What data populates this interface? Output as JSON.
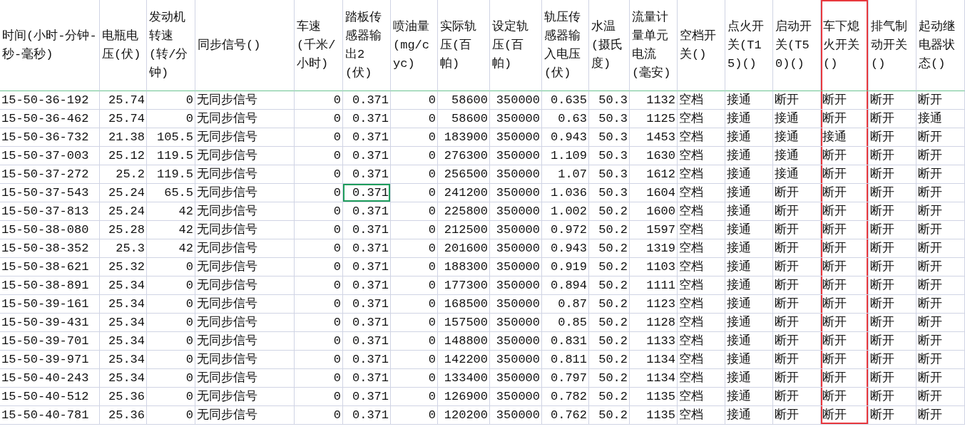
{
  "columns": [
    {
      "label": "时间(小时-分钟-秒-毫秒)",
      "kind": "text",
      "highlighted": false
    },
    {
      "label": "电瓶电压(伏)",
      "kind": "number",
      "highlighted": false
    },
    {
      "label": "发动机转速(转/分钟)",
      "kind": "number",
      "highlighted": false
    },
    {
      "label": "同步信号()",
      "kind": "text",
      "highlighted": false
    },
    {
      "label": "车速(千米/小时)",
      "kind": "number",
      "highlighted": false
    },
    {
      "label": "踏板传感器输出2(伏)",
      "kind": "number",
      "highlighted": false
    },
    {
      "label": "喷油量(mg/cyc)",
      "kind": "number",
      "highlighted": false
    },
    {
      "label": "实际轨压(百帕)",
      "kind": "number",
      "highlighted": false
    },
    {
      "label": "设定轨压(百帕)",
      "kind": "number",
      "highlighted": false
    },
    {
      "label": "轨压传感器输入电压(伏)",
      "kind": "number",
      "highlighted": false
    },
    {
      "label": "水温(摄氏度)",
      "kind": "number",
      "highlighted": false
    },
    {
      "label": "流量计量单元电流(毫安)",
      "kind": "number",
      "highlighted": false
    },
    {
      "label": "空档开关()",
      "kind": "text",
      "highlighted": false
    },
    {
      "label": "点火开关(T15)()",
      "kind": "text",
      "highlighted": false
    },
    {
      "label": "启动开关(T50)()",
      "kind": "text",
      "highlighted": false
    },
    {
      "label": "车下熄火开关()",
      "kind": "text",
      "highlighted": true
    },
    {
      "label": "排气制动开关()",
      "kind": "text",
      "highlighted": false
    },
    {
      "label": "起动继电器状态()",
      "kind": "text",
      "highlighted": false
    }
  ],
  "rows": [
    {
      "cells": [
        "15-50-36-192",
        "25.74",
        "0",
        "无同步信号",
        "0",
        "0.371",
        "0",
        "58600",
        "350000",
        "0.635",
        "50.3",
        "1132",
        "空档",
        "接通",
        "断开",
        "断开",
        "断开",
        "断开"
      ],
      "selected_cell": [
        false,
        false,
        false,
        false,
        false,
        false,
        false,
        false,
        false,
        false,
        false,
        false,
        false,
        false,
        false,
        false,
        false,
        false
      ]
    },
    {
      "cells": [
        "15-50-36-462",
        "25.74",
        "0",
        "无同步信号",
        "0",
        "0.371",
        "0",
        "58600",
        "350000",
        "0.63",
        "50.3",
        "1125",
        "空档",
        "接通",
        "接通",
        "断开",
        "断开",
        "接通"
      ],
      "selected_cell": [
        false,
        false,
        false,
        false,
        false,
        false,
        false,
        false,
        false,
        false,
        false,
        false,
        false,
        false,
        false,
        false,
        false,
        false
      ]
    },
    {
      "cells": [
        "15-50-36-732",
        "21.38",
        "105.5",
        "无同步信号",
        "0",
        "0.371",
        "0",
        "183900",
        "350000",
        "0.943",
        "50.3",
        "1453",
        "空档",
        "接通",
        "接通",
        "接通",
        "断开",
        "断开"
      ],
      "selected_cell": [
        false,
        false,
        false,
        false,
        false,
        false,
        false,
        false,
        false,
        false,
        false,
        false,
        false,
        false,
        false,
        false,
        false,
        false
      ]
    },
    {
      "cells": [
        "15-50-37-003",
        "25.12",
        "119.5",
        "无同步信号",
        "0",
        "0.371",
        "0",
        "276300",
        "350000",
        "1.109",
        "50.3",
        "1630",
        "空档",
        "接通",
        "接通",
        "断开",
        "断开",
        "断开"
      ],
      "selected_cell": [
        false,
        false,
        false,
        false,
        false,
        false,
        false,
        false,
        false,
        false,
        false,
        false,
        false,
        false,
        false,
        false,
        false,
        false
      ]
    },
    {
      "cells": [
        "15-50-37-272",
        "25.2",
        "119.5",
        "无同步信号",
        "0",
        "0.371",
        "0",
        "256500",
        "350000",
        "1.07",
        "50.3",
        "1612",
        "空档",
        "接通",
        "接通",
        "断开",
        "断开",
        "断开"
      ],
      "selected_cell": [
        false,
        false,
        false,
        false,
        false,
        false,
        false,
        false,
        false,
        false,
        false,
        false,
        false,
        false,
        false,
        false,
        false,
        false
      ]
    },
    {
      "cells": [
        "15-50-37-543",
        "25.24",
        "65.5",
        "无同步信号",
        "0",
        "0.371",
        "0",
        "241200",
        "350000",
        "1.036",
        "50.3",
        "1604",
        "空档",
        "接通",
        "断开",
        "断开",
        "断开",
        "断开"
      ],
      "selected_cell": [
        false,
        false,
        false,
        false,
        false,
        true,
        false,
        false,
        false,
        false,
        false,
        false,
        false,
        false,
        false,
        false,
        false,
        false
      ]
    },
    {
      "cells": [
        "15-50-37-813",
        "25.24",
        "42",
        "无同步信号",
        "0",
        "0.371",
        "0",
        "225800",
        "350000",
        "1.002",
        "50.2",
        "1600",
        "空档",
        "接通",
        "断开",
        "断开",
        "断开",
        "断开"
      ],
      "selected_cell": [
        false,
        false,
        false,
        false,
        false,
        false,
        false,
        false,
        false,
        false,
        false,
        false,
        false,
        false,
        false,
        false,
        false,
        false
      ]
    },
    {
      "cells": [
        "15-50-38-080",
        "25.28",
        "42",
        "无同步信号",
        "0",
        "0.371",
        "0",
        "212500",
        "350000",
        "0.972",
        "50.2",
        "1597",
        "空档",
        "接通",
        "断开",
        "断开",
        "断开",
        "断开"
      ],
      "selected_cell": [
        false,
        false,
        false,
        false,
        false,
        false,
        false,
        false,
        false,
        false,
        false,
        false,
        false,
        false,
        false,
        false,
        false,
        false
      ]
    },
    {
      "cells": [
        "15-50-38-352",
        "25.3",
        "42",
        "无同步信号",
        "0",
        "0.371",
        "0",
        "201600",
        "350000",
        "0.943",
        "50.2",
        "1319",
        "空档",
        "接通",
        "断开",
        "断开",
        "断开",
        "断开"
      ],
      "selected_cell": [
        false,
        false,
        false,
        false,
        false,
        false,
        false,
        false,
        false,
        false,
        false,
        false,
        false,
        false,
        false,
        false,
        false,
        false
      ]
    },
    {
      "cells": [
        "15-50-38-621",
        "25.32",
        "0",
        "无同步信号",
        "0",
        "0.371",
        "0",
        "188300",
        "350000",
        "0.919",
        "50.2",
        "1103",
        "空档",
        "接通",
        "断开",
        "断开",
        "断开",
        "断开"
      ],
      "selected_cell": [
        false,
        false,
        false,
        false,
        false,
        false,
        false,
        false,
        false,
        false,
        false,
        false,
        false,
        false,
        false,
        false,
        false,
        false
      ]
    },
    {
      "cells": [
        "15-50-38-891",
        "25.34",
        "0",
        "无同步信号",
        "0",
        "0.371",
        "0",
        "177300",
        "350000",
        "0.894",
        "50.2",
        "1111",
        "空档",
        "接通",
        "断开",
        "断开",
        "断开",
        "断开"
      ],
      "selected_cell": [
        false,
        false,
        false,
        false,
        false,
        false,
        false,
        false,
        false,
        false,
        false,
        false,
        false,
        false,
        false,
        false,
        false,
        false
      ]
    },
    {
      "cells": [
        "15-50-39-161",
        "25.34",
        "0",
        "无同步信号",
        "0",
        "0.371",
        "0",
        "168500",
        "350000",
        "0.87",
        "50.2",
        "1123",
        "空档",
        "接通",
        "断开",
        "断开",
        "断开",
        "断开"
      ],
      "selected_cell": [
        false,
        false,
        false,
        false,
        false,
        false,
        false,
        false,
        false,
        false,
        false,
        false,
        false,
        false,
        false,
        false,
        false,
        false
      ]
    },
    {
      "cells": [
        "15-50-39-431",
        "25.34",
        "0",
        "无同步信号",
        "0",
        "0.371",
        "0",
        "157500",
        "350000",
        "0.85",
        "50.2",
        "1128",
        "空档",
        "接通",
        "断开",
        "断开",
        "断开",
        "断开"
      ],
      "selected_cell": [
        false,
        false,
        false,
        false,
        false,
        false,
        false,
        false,
        false,
        false,
        false,
        false,
        false,
        false,
        false,
        false,
        false,
        false
      ]
    },
    {
      "cells": [
        "15-50-39-701",
        "25.34",
        "0",
        "无同步信号",
        "0",
        "0.371",
        "0",
        "148800",
        "350000",
        "0.831",
        "50.2",
        "1133",
        "空档",
        "接通",
        "断开",
        "断开",
        "断开",
        "断开"
      ],
      "selected_cell": [
        false,
        false,
        false,
        false,
        false,
        false,
        false,
        false,
        false,
        false,
        false,
        false,
        false,
        false,
        false,
        false,
        false,
        false
      ]
    },
    {
      "cells": [
        "15-50-39-971",
        "25.34",
        "0",
        "无同步信号",
        "0",
        "0.371",
        "0",
        "142200",
        "350000",
        "0.811",
        "50.2",
        "1134",
        "空档",
        "接通",
        "断开",
        "断开",
        "断开",
        "断开"
      ],
      "selected_cell": [
        false,
        false,
        false,
        false,
        false,
        false,
        false,
        false,
        false,
        false,
        false,
        false,
        false,
        false,
        false,
        false,
        false,
        false
      ]
    },
    {
      "cells": [
        "15-50-40-243",
        "25.34",
        "0",
        "无同步信号",
        "0",
        "0.371",
        "0",
        "133400",
        "350000",
        "0.797",
        "50.2",
        "1134",
        "空档",
        "接通",
        "断开",
        "断开",
        "断开",
        "断开"
      ],
      "selected_cell": [
        false,
        false,
        false,
        false,
        false,
        false,
        false,
        false,
        false,
        false,
        false,
        false,
        false,
        false,
        false,
        false,
        false,
        false
      ]
    },
    {
      "cells": [
        "15-50-40-512",
        "25.36",
        "0",
        "无同步信号",
        "0",
        "0.371",
        "0",
        "126900",
        "350000",
        "0.782",
        "50.2",
        "1135",
        "空档",
        "接通",
        "断开",
        "断开",
        "断开",
        "断开"
      ],
      "selected_cell": [
        false,
        false,
        false,
        false,
        false,
        false,
        false,
        false,
        false,
        false,
        false,
        false,
        false,
        false,
        false,
        false,
        false,
        false
      ]
    },
    {
      "cells": [
        "15-50-40-781",
        "25.36",
        "0",
        "无同步信号",
        "0",
        "0.371",
        "0",
        "120200",
        "350000",
        "0.762",
        "50.2",
        "1135",
        "空档",
        "接通",
        "断开",
        "断开",
        "断开",
        "断开"
      ],
      "selected_cell": [
        false,
        false,
        false,
        false,
        false,
        false,
        false,
        false,
        false,
        false,
        false,
        false,
        false,
        false,
        false,
        false,
        false,
        false
      ]
    }
  ]
}
